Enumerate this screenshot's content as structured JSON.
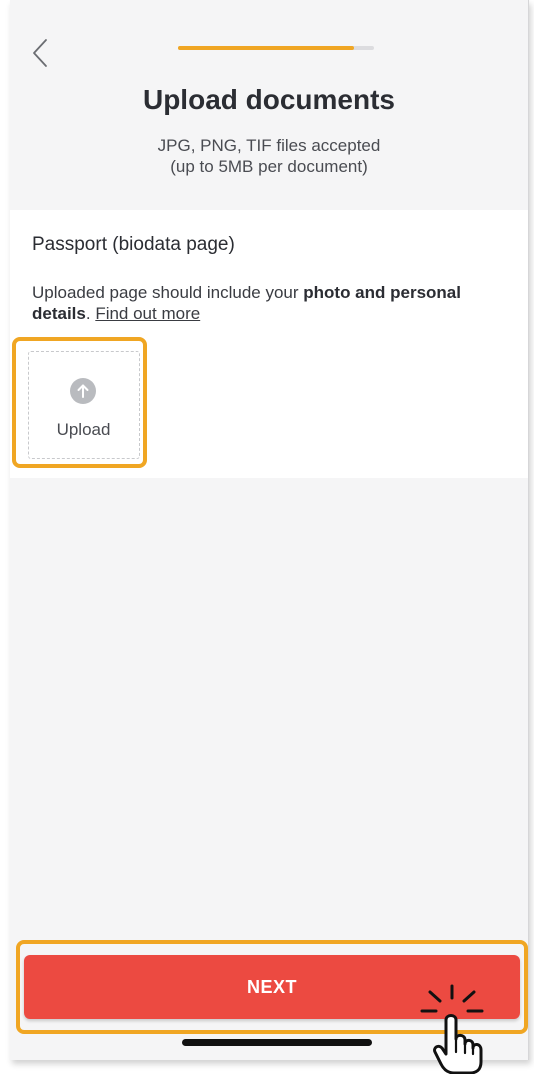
{
  "header": {
    "title": "Upload documents",
    "subtitle_line1": "JPG, PNG, TIF files accepted",
    "subtitle_line2": "(up to 5MB per document)",
    "progress_fraction": 0.9
  },
  "section": {
    "title": "Passport (biodata page)",
    "desc_prefix": "Uploaded page should include your ",
    "desc_bold": "photo and personal details",
    "desc_suffix": ". ",
    "link": "Find out more"
  },
  "upload": {
    "label": "Upload",
    "icon": "arrow-up-icon"
  },
  "footer": {
    "next_label": "NEXT"
  },
  "colors": {
    "accent": "#f0a623",
    "primary_button": "#ec4a41"
  }
}
